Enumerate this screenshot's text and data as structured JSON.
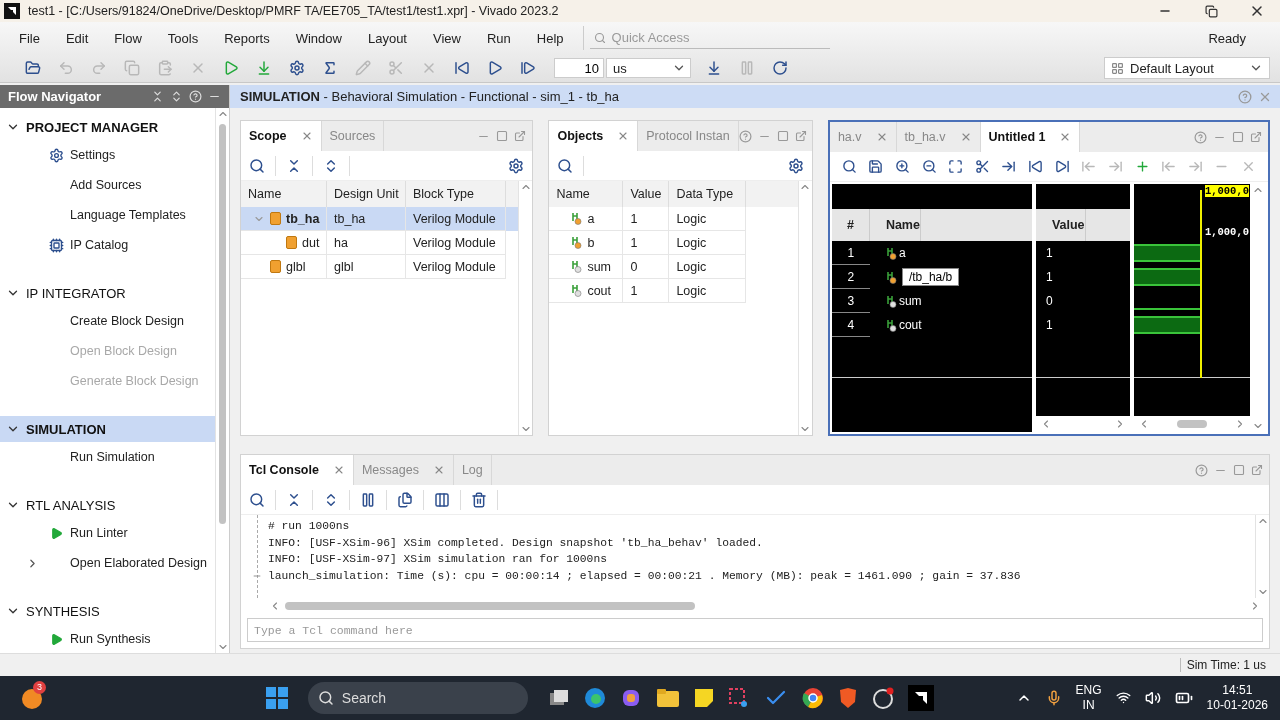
{
  "window": {
    "title": "test1 - [C:/Users/91824/OneDrive/Desktop/PMRF TA/EE705_TA/test1/test1.xpr] - Vivado 2023.2"
  },
  "menu": [
    "File",
    "Edit",
    "Flow",
    "Tools",
    "Reports",
    "Window",
    "Layout",
    "View",
    "Run",
    "Help"
  ],
  "quick_access": {
    "placeholder": "Quick Access"
  },
  "status": "Ready",
  "toolbar_left": [
    {
      "disabled": false
    },
    {
      "disabled": true
    },
    {
      "disabled": true
    },
    {
      "disabled": true
    },
    {
      "disabled": true
    },
    {
      "disabled": true
    },
    {
      "disabled": false
    },
    {
      "disabled": false
    },
    {
      "disabled": false
    },
    {
      "disabled": false
    },
    {
      "disabled": true
    },
    {
      "disabled": true
    },
    {
      "disabled": true
    },
    {
      "disabled": false
    },
    {
      "disabled": false
    },
    {
      "disabled": false
    }
  ],
  "run_time": {
    "value": "10",
    "unit": "us"
  },
  "toolbar_right": [
    {
      "disabled": false
    },
    {
      "disabled": true
    },
    {
      "disabled": false
    }
  ],
  "layout_select": "Default Layout",
  "flow_navigator": {
    "title": "Flow Navigator",
    "sections": [
      {
        "title": "PROJECT MANAGER",
        "bold": true,
        "selected": false,
        "expanded": true,
        "items": [
          {
            "label": "Settings",
            "kind": "settings",
            "disabled": false
          },
          {
            "label": "Add Sources",
            "kind": "plain",
            "disabled": false
          },
          {
            "label": "Language Templates",
            "kind": "plain",
            "disabled": false
          },
          {
            "label": "IP Catalog",
            "kind": "ip",
            "disabled": false
          }
        ]
      },
      {
        "title": "IP INTEGRATOR",
        "bold": false,
        "selected": false,
        "expanded": true,
        "items": [
          {
            "label": "Create Block Design",
            "kind": "plain",
            "disabled": false
          },
          {
            "label": "Open Block Design",
            "kind": "plain",
            "disabled": true
          },
          {
            "label": "Generate Block Design",
            "kind": "plain",
            "disabled": true
          }
        ]
      },
      {
        "title": "SIMULATION",
        "bold": true,
        "selected": true,
        "expanded": true,
        "items": [
          {
            "label": "Run Simulation",
            "kind": "plain",
            "disabled": false
          }
        ]
      },
      {
        "title": "RTL ANALYSIS",
        "bold": false,
        "selected": false,
        "expanded": true,
        "items": [
          {
            "label": "Run Linter",
            "kind": "run",
            "disabled": false
          },
          {
            "label": "Open Elaborated Design",
            "kind": "group",
            "disabled": false,
            "expanded": false
          }
        ]
      },
      {
        "title": "SYNTHESIS",
        "bold": false,
        "selected": false,
        "expanded": true,
        "items": [
          {
            "label": "Run Synthesis",
            "kind": "run",
            "disabled": false
          }
        ]
      }
    ]
  },
  "simulation_header": "**SIMULATION** - Behavioral Simulation - Functional - sim_1 - tb_ha",
  "scope_panel": {
    "tabs": [
      {
        "label": "Scope",
        "selected": true
      },
      {
        "label": "Sources",
        "selected": false
      }
    ],
    "columns": [
      "Name",
      "Design Unit",
      "Block Type"
    ],
    "rows": [
      {
        "name": "tb_ha",
        "design_unit": "tb_ha",
        "block_type": "Verilog Module",
        "selected": true,
        "expanded": true,
        "children": [
          {
            "name": "dut",
            "design_unit": "ha",
            "block_type": "Verilog Module",
            "selected": false
          }
        ]
      },
      {
        "name": "glbl",
        "design_unit": "glbl",
        "block_type": "Verilog Module",
        "selected": false
      }
    ]
  },
  "objects_panel": {
    "tabs": [
      {
        "label": "Objects",
        "selected": true
      },
      {
        "label": "Protocol Instan",
        "selected": false
      }
    ],
    "columns": [
      "Name",
      "Value",
      "Data Type"
    ],
    "rows": [
      {
        "name": "a",
        "value": "1",
        "data_type": "Logic",
        "kind": "input"
      },
      {
        "name": "b",
        "value": "1",
        "data_type": "Logic",
        "kind": "input"
      },
      {
        "name": "sum",
        "value": "0",
        "data_type": "Logic",
        "kind": "output"
      },
      {
        "name": "cout",
        "value": "1",
        "data_type": "Logic",
        "kind": "output"
      }
    ]
  },
  "wave_panel": {
    "tabs": [
      {
        "label": "ha.v",
        "selected": false
      },
      {
        "label": "tb_ha.v",
        "selected": false
      },
      {
        "label": "Untitled 1",
        "selected": true
      }
    ],
    "toolbar": [
      {
        "disabled": false
      },
      {
        "disabled": false
      },
      {
        "disabled": false
      },
      {
        "disabled": false
      },
      {
        "disabled": false
      },
      {
        "disabled": false
      },
      {
        "disabled": false
      },
      {
        "disabled": false
      },
      {
        "disabled": false
      },
      {
        "disabled": true
      },
      {
        "disabled": true
      },
      {
        "disabled": false
      },
      {
        "disabled": true
      },
      {
        "disabled": true
      },
      {
        "disabled": true
      },
      {
        "disabled": true
      }
    ],
    "columns": [
      "#",
      "Name",
      "Value"
    ],
    "cursor_labels": [
      "1,000,0",
      "1,000,0"
    ],
    "signals": [
      {
        "number": "1",
        "name": "a",
        "value": "1",
        "kind": "input",
        "high": true
      },
      {
        "number": "2",
        "tooltip": "/tb_ha/b",
        "value": "1",
        "kind": "input",
        "high": true
      },
      {
        "number": "3",
        "name": "sum",
        "value": "0",
        "kind": "output",
        "high": false
      },
      {
        "number": "4",
        "name": "cout",
        "value": "1",
        "kind": "output",
        "high": true
      }
    ]
  },
  "console": {
    "tabs": [
      {
        "label": "Tcl Console",
        "selected": true
      },
      {
        "label": "Messages",
        "selected": false
      },
      {
        "label": "Log",
        "selected": false
      }
    ],
    "lines": [
      {
        "text": "# run 1000ns",
        "fold": false
      },
      {
        "text": "INFO: [USF-XSim-96] XSim completed. Design snapshot 'tb_ha_behav' loaded.",
        "fold": false
      },
      {
        "text": "INFO: [USF-XSim-97] XSim simulation ran for 1000ns",
        "fold": false
      },
      {
        "text": "launch_simulation: Time (s): cpu = 00:00:14 ; elapsed = 00:00:21 . Memory (MB): peak = 1461.090 ; gain = 37.836",
        "fold": true
      }
    ],
    "placeholder": "Type a Tcl command here"
  },
  "status_bar": {
    "sim_time": "Sim Time: 1 us"
  },
  "taskbar": {
    "notification_count": "3",
    "search_placeholder": "Search",
    "language": "ENG",
    "region": "IN",
    "time": "14:51",
    "date": "10-01-2026"
  }
}
